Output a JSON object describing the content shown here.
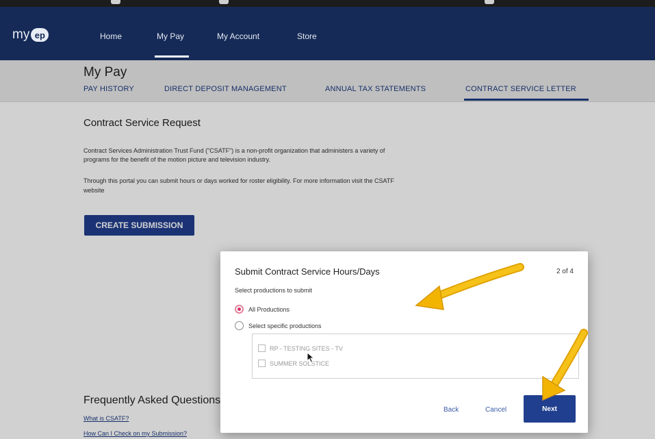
{
  "nav": {
    "logo_text": "my",
    "logo_badge": "ep",
    "items": [
      {
        "label": "Home"
      },
      {
        "label": "My Pay"
      },
      {
        "label": "My Account"
      },
      {
        "label": "Store"
      }
    ],
    "active": "My Pay"
  },
  "subheader": {
    "title": "My Pay",
    "tabs": [
      {
        "label": "PAY HISTORY"
      },
      {
        "label": "DIRECT DEPOSIT MANAGEMENT"
      },
      {
        "label": "ANNUAL TAX STATEMENTS"
      },
      {
        "label": "CONTRACT SERVICE LETTER"
      }
    ],
    "active_tab": "CONTRACT SERVICE LETTER"
  },
  "main": {
    "section_title": "Contract Service Request",
    "para1_line1": "Contract Services Administration Trust Fund (\"CSATF\") is a non-profit organization that administers a variety of",
    "para1_line2": "programs for the benefit of the motion picture and television industry.",
    "para2_line1": "Through this portal you can submit hours or days worked for roster eligibility. For more information visit the CSATF",
    "para2_line2": "website",
    "create_button": "CREATE SUBMISSION",
    "faq_title": "Frequently Asked Questions",
    "faq_links": [
      {
        "label": "What is CSATF?"
      },
      {
        "label": "How Can I Check on my Submission?"
      }
    ]
  },
  "modal": {
    "title": "Submit Contract Service Hours/Days",
    "step": "2 of 4",
    "subtitle": "Select productions to submit",
    "options": [
      {
        "label": "All Productions",
        "checked": true
      },
      {
        "label": "Select specific productions",
        "checked": false
      }
    ],
    "productions": [
      {
        "label": "RP - TESTING SITES - TV",
        "checked": false
      },
      {
        "label": "SUMMER SOLSTICE",
        "checked": false
      }
    ],
    "back_label": "Back",
    "cancel_label": "Cancel",
    "next_label": "Next"
  },
  "colors": {
    "navbar": "#152a57",
    "accent": "#213f8f",
    "radio_selected": "#d6306a",
    "annotation_arrow": "#f2b400"
  },
  "icons": [
    "cursor-arrow-icon",
    "annotation-arrow-icon"
  ]
}
